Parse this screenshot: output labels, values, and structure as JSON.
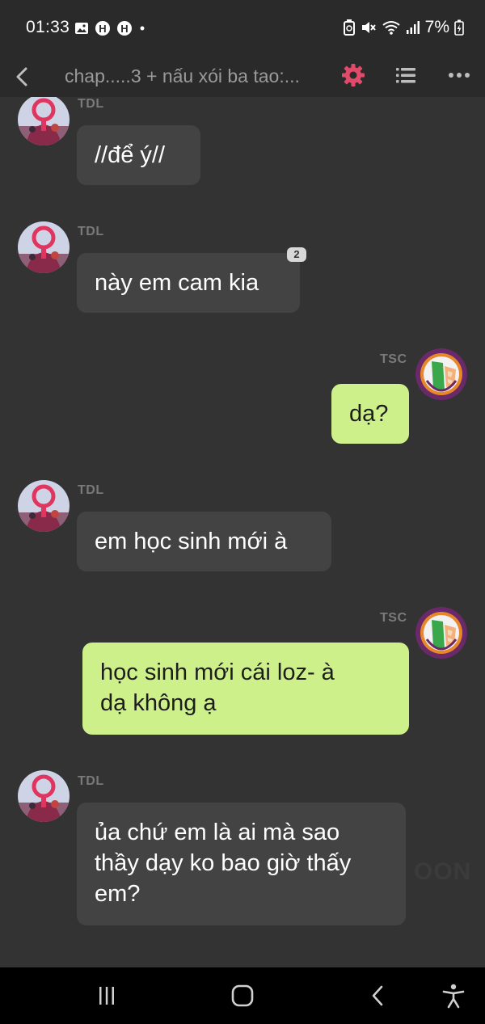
{
  "status_bar": {
    "time": "01:33",
    "battery": "7%",
    "left_icons": [
      "gallery-icon",
      "h-app-icon",
      "h-app-icon",
      "dot-icon"
    ],
    "right_icons": [
      "recycle-icon",
      "mute-icon",
      "wifi-icon",
      "signal-icon",
      "battery-charging-icon"
    ]
  },
  "app_bar": {
    "title": "chap.....3 + nấu xói ba tao:...",
    "accent_color": "#e24a6b"
  },
  "messages": [
    {
      "sender": "TDL",
      "direction": "in",
      "lines": [
        "//để ý//"
      ]
    },
    {
      "sender": "TDL",
      "direction": "in",
      "lines": [
        "này em cam kia"
      ],
      "badge": "2"
    },
    {
      "sender": "TSC",
      "direction": "out",
      "lines": [
        "dạ?"
      ]
    },
    {
      "sender": "TDL",
      "direction": "in",
      "lines": [
        "em học sinh mới à"
      ]
    },
    {
      "sender": "TSC",
      "direction": "out",
      "lines": [
        "học sinh mới cái loz- à",
        "dạ không ạ"
      ]
    },
    {
      "sender": "TDL",
      "direction": "in",
      "lines": [
        "ủa chứ em là ai mà sao",
        "thầy dạy ko bao giờ thấy",
        "em?"
      ]
    }
  ],
  "watermark": "OON",
  "colors": {
    "background": "#333333",
    "incoming_bubble": "#434343",
    "outgoing_bubble": "#cdf08a"
  },
  "nav_bar": {
    "buttons": [
      "recent-apps-icon",
      "home-icon",
      "back-icon",
      "accessibility-icon"
    ]
  }
}
